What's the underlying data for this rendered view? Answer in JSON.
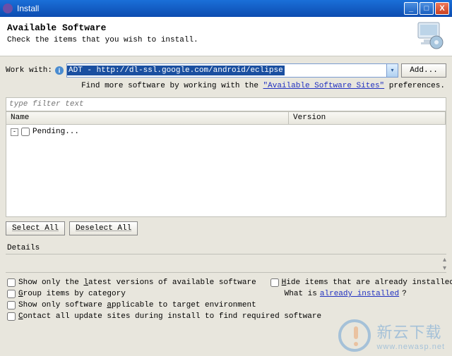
{
  "window": {
    "title": "Install"
  },
  "header": {
    "title": "Available Software",
    "subtitle": "Check the items that you wish to install."
  },
  "work_with": {
    "label": "Work with:",
    "value": "ADT - http://dl-ssl.google.com/android/eclipse",
    "add_button": "Add..."
  },
  "hint": {
    "prefix": "Find more software by working with the ",
    "link": "\"Available Software Sites\"",
    "suffix": " preferences."
  },
  "filter": {
    "placeholder": "type filter text"
  },
  "table": {
    "columns": {
      "name": "Name",
      "version": "Version"
    },
    "rows": [
      {
        "label": "Pending..."
      }
    ]
  },
  "buttons": {
    "select_all": "Select All",
    "deselect_all": "Deselect All"
  },
  "details": {
    "label": "Details"
  },
  "options": {
    "latest": {
      "pre": "Show only the ",
      "u": "l",
      "post": "atest versions of available software"
    },
    "hide": {
      "u": "H",
      "post": "ide items that are already installed"
    },
    "group": {
      "u": "G",
      "post": "roup items by category"
    },
    "what_is": {
      "pre": "What is ",
      "link": "already installed",
      "post": "?"
    },
    "applicable": {
      "pre": "Show only software ",
      "u": "a",
      "post": "pplicable to target environment"
    },
    "contact": {
      "u": "C",
      "post": "ontact all update sites during install to find required software"
    }
  },
  "watermark": {
    "cn": "新云下载",
    "url": "www.newasp.net"
  }
}
